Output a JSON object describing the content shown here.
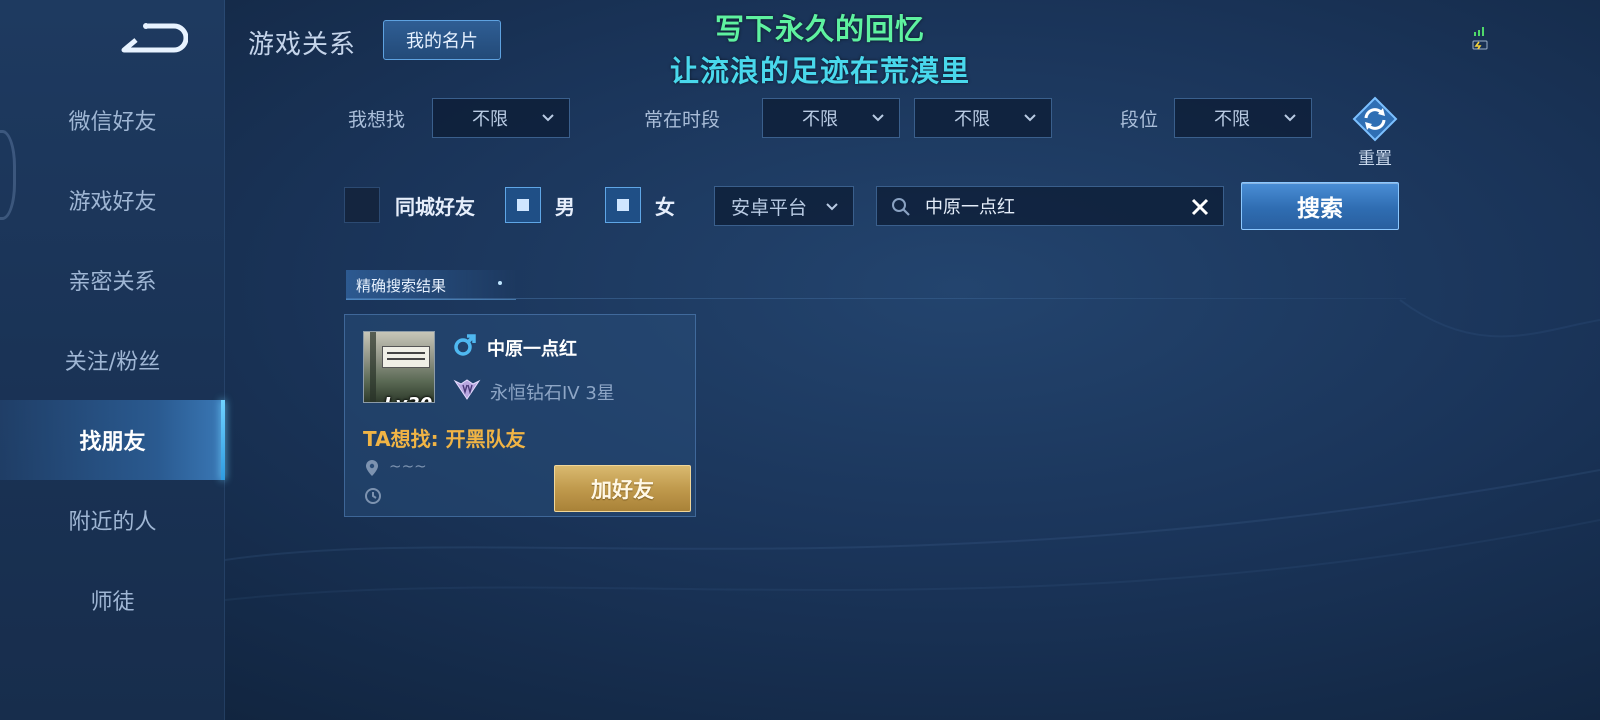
{
  "overlay": {
    "line1": "写下永久的回忆",
    "line2": "让流浪的足迹在荒漠里"
  },
  "header": {
    "title": "游戏关系",
    "card_button": "我的名片"
  },
  "sidebar": {
    "back_icon": "back-arrow-icon",
    "items": [
      {
        "label": "微信好友",
        "active": false
      },
      {
        "label": "游戏好友",
        "active": false
      },
      {
        "label": "亲密关系",
        "active": false
      },
      {
        "label": "关注/粉丝",
        "active": false
      },
      {
        "label": "找朋友",
        "active": true
      },
      {
        "label": "附近的人",
        "active": false
      },
      {
        "label": "师徒",
        "active": false
      }
    ]
  },
  "filters": {
    "looking_for_label": "我想找",
    "looking_for_value": "不限",
    "online_period_label": "常在时段",
    "online_period_from": "不限",
    "online_period_to": "不限",
    "rank_label": "段位",
    "rank_value": "不限",
    "reset_label": "重置"
  },
  "options": {
    "same_city_label": "同城好友",
    "same_city_checked": false,
    "male_label": "男",
    "male_checked": true,
    "female_label": "女",
    "female_checked": true,
    "platform_value": "安卓平台",
    "search_value": "中原一点红",
    "search_button": "搜索"
  },
  "results": {
    "section_title": "精确搜索结果",
    "items": [
      {
        "name": "中原一点红",
        "gender": "male",
        "level_badge": "Lv30",
        "rank": "永恒钻石IV 3星",
        "wants": "TA想找: 开黑队友",
        "location": "~~~",
        "add_button": "加好友"
      }
    ]
  },
  "colors": {
    "accent_blue": "#4a8ed6",
    "gold_button": "#c09a4d",
    "wants_text": "#f0b445",
    "overlay_green": "#5ef2a0",
    "overlay_cyan": "#49d8ec"
  }
}
